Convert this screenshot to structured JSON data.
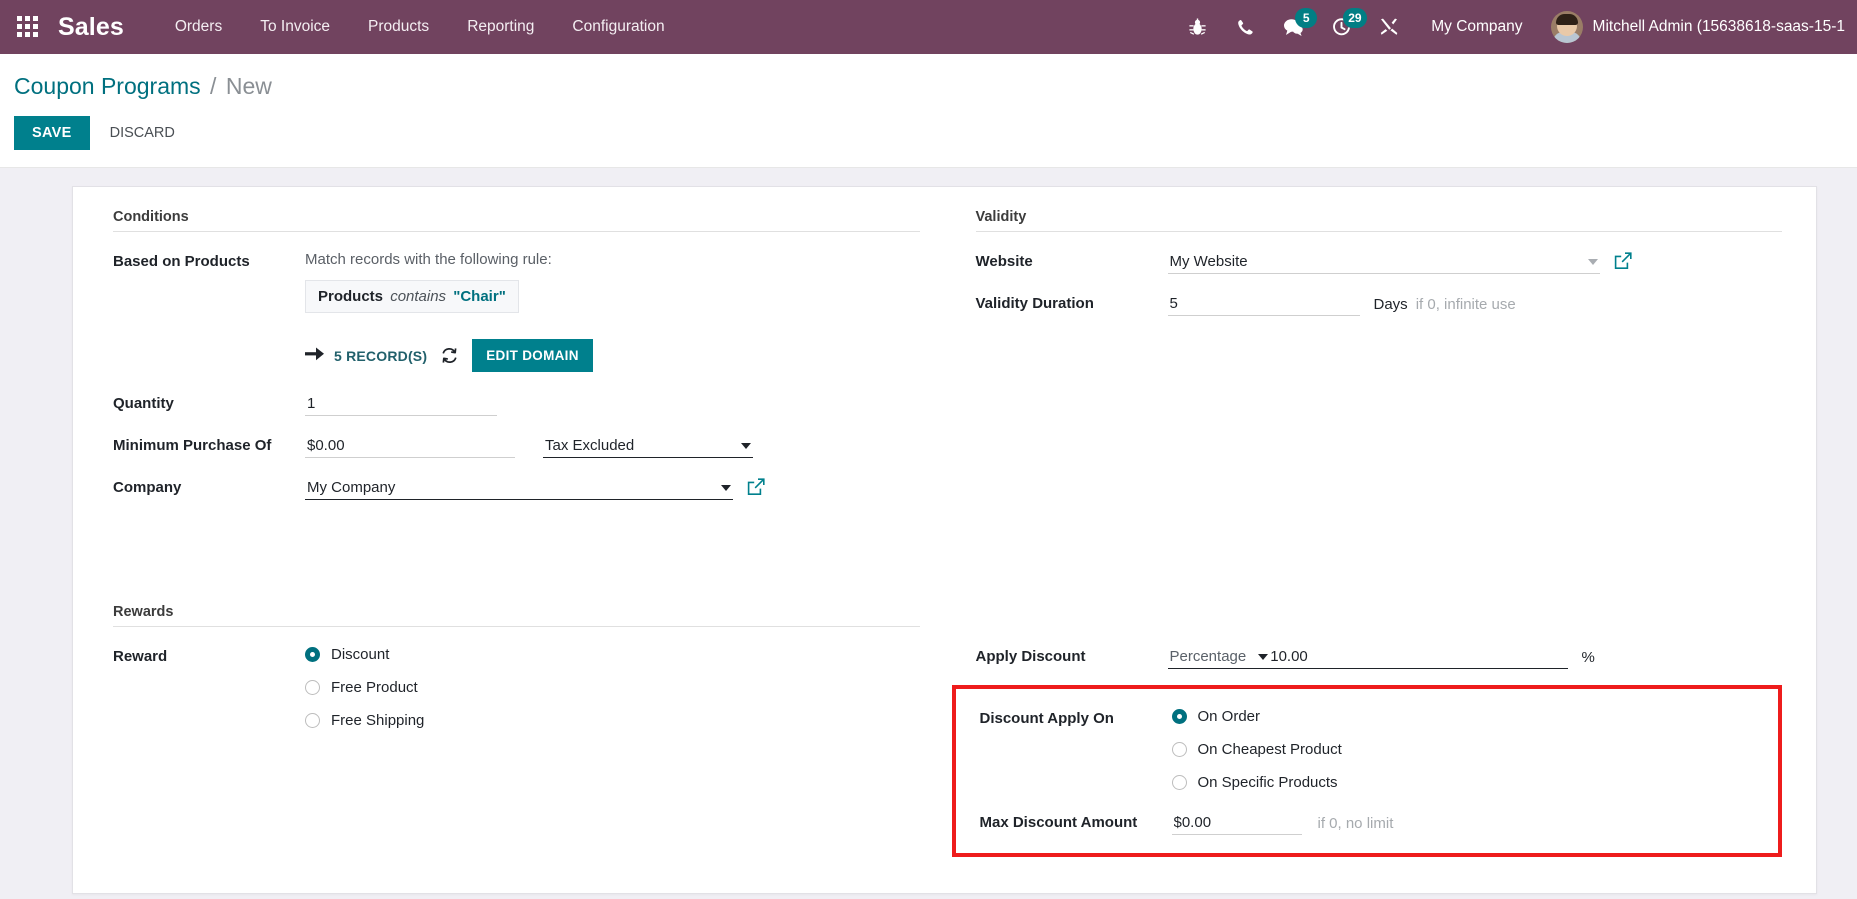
{
  "navbar": {
    "apps_icon": "apps-grid-icon",
    "brand": "Sales",
    "menu": [
      {
        "label": "Orders"
      },
      {
        "label": "To Invoice"
      },
      {
        "label": "Products"
      },
      {
        "label": "Reporting"
      },
      {
        "label": "Configuration"
      }
    ],
    "systray": [
      {
        "name": "bug-icon",
        "badge": null
      },
      {
        "name": "phone-icon",
        "badge": null
      },
      {
        "name": "messages-icon",
        "badge": "5"
      },
      {
        "name": "activities-clock-icon",
        "badge": "29"
      },
      {
        "name": "tools-icon",
        "badge": null
      }
    ],
    "company": "My Company",
    "user": "Mitchell Admin (15638618-saas-15-1"
  },
  "control_panel": {
    "breadcrumb_root": "Coupon Programs",
    "breadcrumb_sep": "/",
    "breadcrumb_current": "New",
    "save_label": "SAVE",
    "discard_label": "DISCARD"
  },
  "form": {
    "conditions": {
      "title": "Conditions",
      "based_on_products_label": "Based on Products",
      "domain_help": "Match records with the following rule:",
      "domain_node": {
        "field": "Products",
        "operator": "contains",
        "value": "\"Chair\""
      },
      "records_count": "5 RECORD(S)",
      "edit_domain_label": "EDIT DOMAIN",
      "quantity_label": "Quantity",
      "quantity_value": "1",
      "minimum_purchase_label": "Minimum Purchase Of",
      "minimum_purchase_value": "$0.00",
      "tax_mode_value": "Tax Excluded",
      "company_label": "Company",
      "company_value": "My Company"
    },
    "validity": {
      "title": "Validity",
      "website_label": "Website",
      "website_value": "My Website",
      "validity_duration_label": "Validity Duration",
      "validity_duration_value": "5",
      "validity_duration_unit": "Days",
      "validity_duration_hint": "if 0, infinite use"
    },
    "rewards": {
      "title": "Rewards",
      "reward_label": "Reward",
      "reward_options": [
        {
          "label": "Discount",
          "selected": true
        },
        {
          "label": "Free Product",
          "selected": false
        },
        {
          "label": "Free Shipping",
          "selected": false
        }
      ],
      "apply_discount_label": "Apply Discount",
      "apply_discount_type": "Percentage",
      "apply_discount_amount": "10.00",
      "apply_discount_suffix": "%",
      "discount_apply_on_label": "Discount Apply On",
      "discount_apply_on_options": [
        {
          "label": "On Order",
          "selected": true
        },
        {
          "label": "On Cheapest Product",
          "selected": false
        },
        {
          "label": "On Specific Products",
          "selected": false
        }
      ],
      "max_discount_label": "Max Discount Amount",
      "max_discount_value": "$0.00",
      "max_discount_hint": "if 0, no limit"
    }
  },
  "colors": {
    "navbar_bg": "#71435F",
    "accent": "#00808d",
    "link": "#00707f",
    "highlight_box": "#ee1c1c",
    "badge": "#017e84"
  }
}
